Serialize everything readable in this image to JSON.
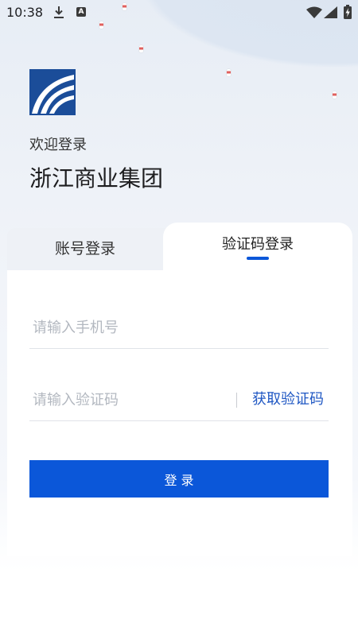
{
  "status_bar": {
    "time": "10:38",
    "a_icon_glyph": "A",
    "left_icons": [
      "download-icon",
      "a-box-icon"
    ],
    "right_icons": [
      "wifi-icon",
      "signal-icon",
      "battery-charging-icon"
    ]
  },
  "brand": {
    "logo_icon": "company-logo",
    "welcome": "欢迎登录",
    "company": "浙江商业集团"
  },
  "tabs": [
    {
      "label": "账号登录",
      "active": false
    },
    {
      "label": "验证码登录",
      "active": true
    }
  ],
  "form": {
    "phone": {
      "placeholder": "请输入手机号",
      "value": ""
    },
    "code": {
      "placeholder": "请输入验证码",
      "value": ""
    },
    "get_code_label": "获取验证码",
    "submit_label": "登 录"
  },
  "colors": {
    "primary": "#0b57d9",
    "link": "#1f57c3",
    "tab_inactive_bg": "#eef1f6"
  }
}
